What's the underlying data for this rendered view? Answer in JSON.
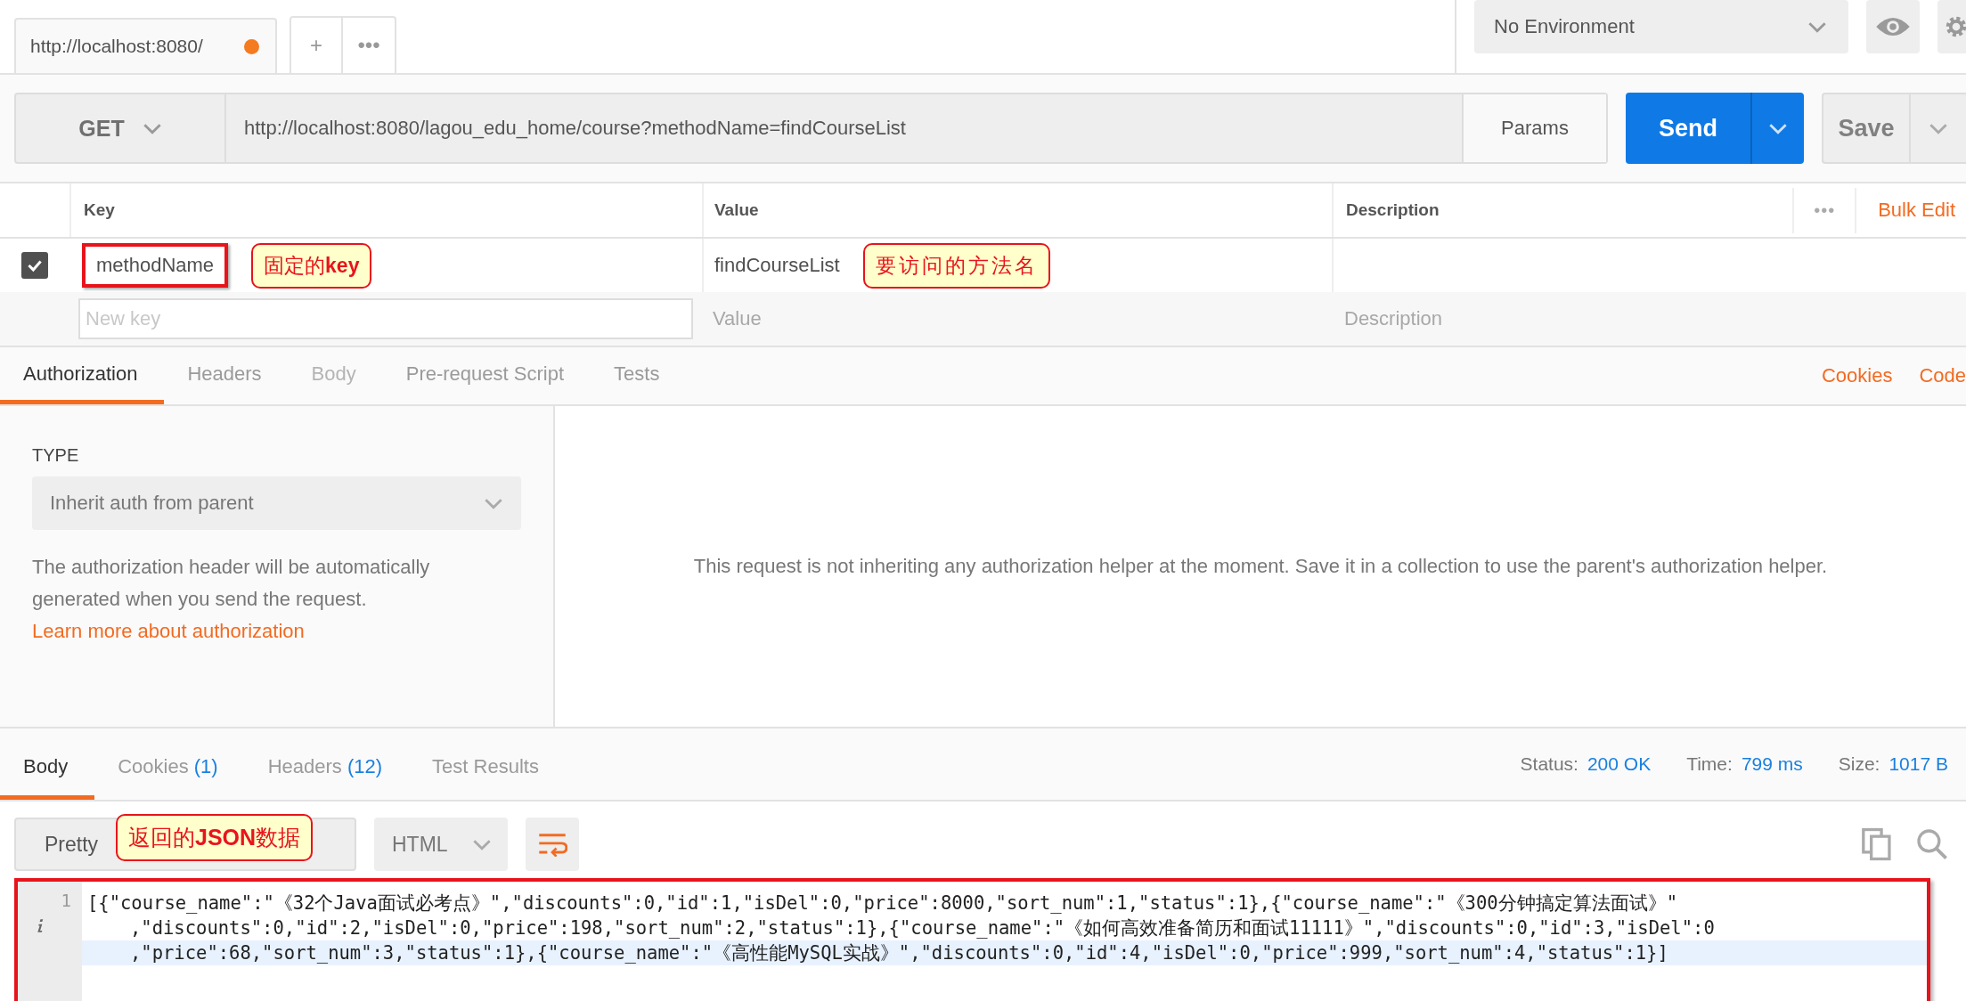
{
  "tabs": [
    {
      "label": "http://localhost:8080/",
      "selected": true,
      "unsaved": true
    }
  ],
  "tab_actions": [
    "+",
    "•••"
  ],
  "environment": {
    "value": "No Environment"
  },
  "request": {
    "method": "GET",
    "url": "http://localhost:8080/lagou_edu_home/course?methodName=findCourseList",
    "params_label": "Params",
    "send_label": "Send",
    "save_label": "Save"
  },
  "params": {
    "columns": [
      "Key",
      "Value",
      "Description"
    ],
    "more": "•••",
    "bulk_edit": "Bulk Edit",
    "rows": [
      {
        "checked": true,
        "key": "methodName",
        "key_highlighted": true,
        "key_note": "固定的**key**",
        "value": "findCourseList",
        "value_note": "要访问的方法名"
      }
    ],
    "new_row": {
      "key_placeholder": "New key",
      "value_placeholder": "Value",
      "description_placeholder": "Description"
    }
  },
  "request_tabs": [
    {
      "label": "Authorization",
      "selected": true,
      "disabled": false
    },
    {
      "label": "Headers",
      "selected": false,
      "disabled": false
    },
    {
      "label": "Body",
      "selected": false,
      "disabled": true
    },
    {
      "label": "Pre-request Script",
      "selected": false,
      "disabled": false
    },
    {
      "label": "Tests",
      "selected": false,
      "disabled": false
    }
  ],
  "request_links": [
    "Cookies",
    "Code"
  ],
  "auth": {
    "type_label": "TYPE",
    "type_value": "Inherit auth from parent",
    "help": "The authorization header will be automatically generated when you send the request.",
    "help_link": "Learn more about authorization",
    "message": "This request is not inheriting any authorization helper at the moment. Save it in a collection to use the parent's authorization helper."
  },
  "response_tabs": [
    {
      "label": "Body",
      "selected": true
    },
    {
      "label": "Cookies",
      "count": "(1)",
      "selected": false
    },
    {
      "label": "Headers",
      "count": "(12)",
      "selected": false
    },
    {
      "label": "Test Results",
      "selected": false
    }
  ],
  "response_meta": [
    {
      "label": "Status:",
      "value": "200 OK"
    },
    {
      "label": "Time:",
      "value": "799 ms"
    },
    {
      "label": "Size:",
      "value": "1017 B"
    }
  ],
  "body_toolbar": {
    "format": "Pretty",
    "format_note": "返回的**JSON**数据",
    "language": "HTML",
    "wrap_on": true
  },
  "body": {
    "highlighted": true,
    "lines": [
      {
        "number": "1",
        "segments": [
          "[{\"course_name\":\"《32个Java面试必考点》\",\"discounts\":0,\"id\":1,\"isDel\":0,\"price\":8000,\"sort_num\":1,\"status\":1},{\"course_name\":\"《300分钟搞定算法面试》\"",
          ",\"discounts\":0,\"id\":2,\"isDel\":0,\"price\":198,\"sort_num\":2,\"status\":1},{\"course_name\":\"《如何高效准备简历和面试11111》\",\"discounts\":0,\"id\":3,\"isDel\":0",
          ",\"price\":68,\"sort_num\":3,\"status\":1},{\"course_name\":\"《高性能MySQL实战》\",\"discounts\":0,\"id\":4,\"isDel\":0,\"price\":999,\"sort_num\":4,\"status\":1}]"
        ]
      }
    ]
  }
}
